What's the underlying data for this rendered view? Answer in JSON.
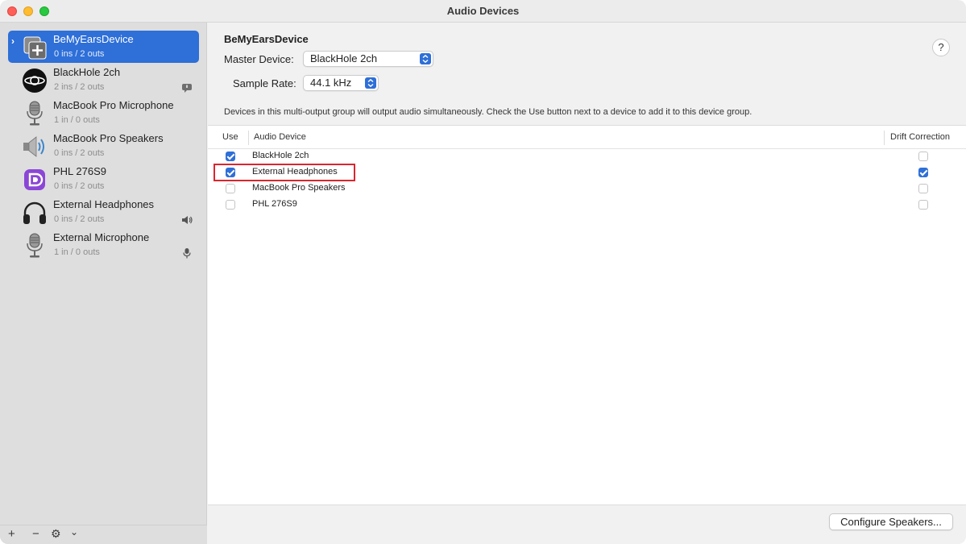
{
  "window": {
    "title": "Audio Devices"
  },
  "sidebar": {
    "items": [
      {
        "name": "BeMyEarsDevice",
        "sub": "0 ins / 2 outs",
        "icon": "aggregate-device-icon",
        "selected": true
      },
      {
        "name": "BlackHole 2ch",
        "sub": "2 ins / 2 outs",
        "icon": "blackhole-icon",
        "badge": "alert-bubble-icon"
      },
      {
        "name": "MacBook Pro Microphone",
        "sub": "1 in / 0 outs",
        "icon": "microphone-icon"
      },
      {
        "name": "MacBook Pro Speakers",
        "sub": "0 ins / 2 outs",
        "icon": "speaker-icon"
      },
      {
        "name": "PHL 276S9",
        "sub": "0 ins / 2 outs",
        "icon": "display-port-icon"
      },
      {
        "name": "External Headphones",
        "sub": "0 ins / 2 outs",
        "icon": "headphones-icon",
        "badge": "speaker-volume-icon"
      },
      {
        "name": "External Microphone",
        "sub": "1 in / 0 outs",
        "icon": "microphone-icon",
        "badge": "mic-badge-icon"
      }
    ],
    "bottom": {
      "add": "+",
      "remove": "−",
      "gear": "⚙",
      "menu": "⌄"
    }
  },
  "main": {
    "title": "BeMyEarsDevice",
    "master_label": "Master Device:",
    "master_value": "BlackHole 2ch",
    "rate_label": "Sample Rate:",
    "rate_value": "44.1 kHz",
    "help": "?",
    "description": "Devices in this multi-output group will output audio simultaneously. Check the Use button next to a device to add it to this device group.",
    "table": {
      "headers": {
        "use": "Use",
        "device": "Audio Device",
        "drift": "Drift Correction"
      },
      "rows": [
        {
          "name": "BlackHole 2ch",
          "use": true,
          "drift": false
        },
        {
          "name": "External Headphones",
          "use": true,
          "drift": true,
          "highlight": true
        },
        {
          "name": "MacBook Pro Speakers",
          "use": false,
          "drift": false
        },
        {
          "name": "PHL 276S9",
          "use": false,
          "drift": false
        }
      ]
    },
    "configure_button": "Configure Speakers..."
  },
  "colors": {
    "accent": "#2e6fd8",
    "highlight": "#d9262f"
  }
}
